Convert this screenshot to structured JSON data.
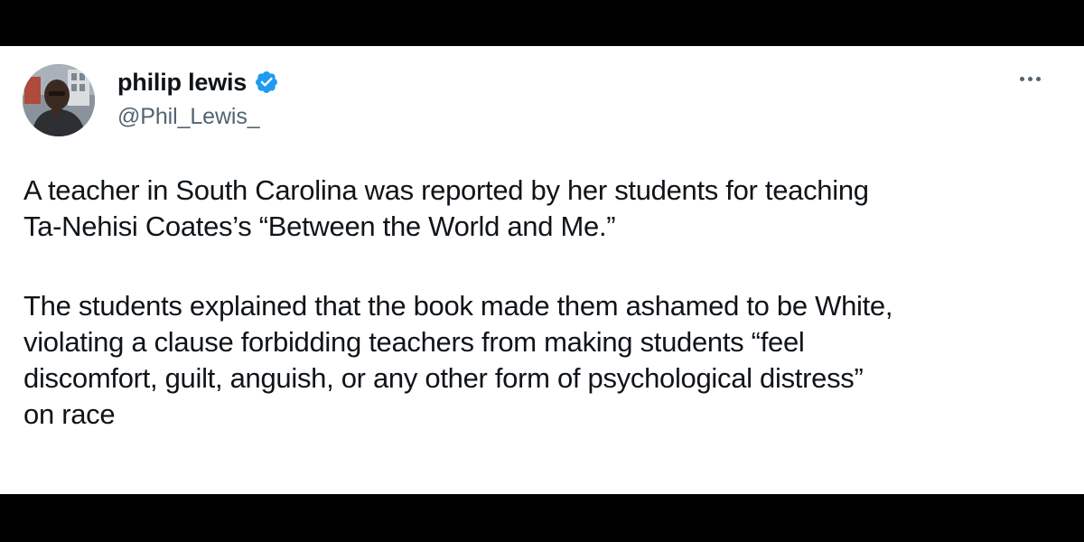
{
  "author": {
    "display_name": "philip lewis",
    "handle": "@Phil_Lewis_",
    "verified": true,
    "avatar_icon": "profile-photo",
    "verified_icon": "verified-badge-icon",
    "verified_color": "#1d9bf0"
  },
  "menu": {
    "icon": "more-options-icon"
  },
  "tweet": {
    "paragraphs": [
      "A teacher in South Carolina was reported by her students for teaching\nTa-Nehisi Coates’s “Between the World and Me.”",
      "The students explained that the book made them ashamed to be White,\nviolating a clause forbidding teachers from making students “feel\ndiscomfort, guilt, anguish, or any other form of psychological distress”\non race"
    ]
  },
  "colors": {
    "text_primary": "#0f1419",
    "text_secondary": "#536471",
    "background": "#ffffff",
    "letterbox": "#000000"
  }
}
